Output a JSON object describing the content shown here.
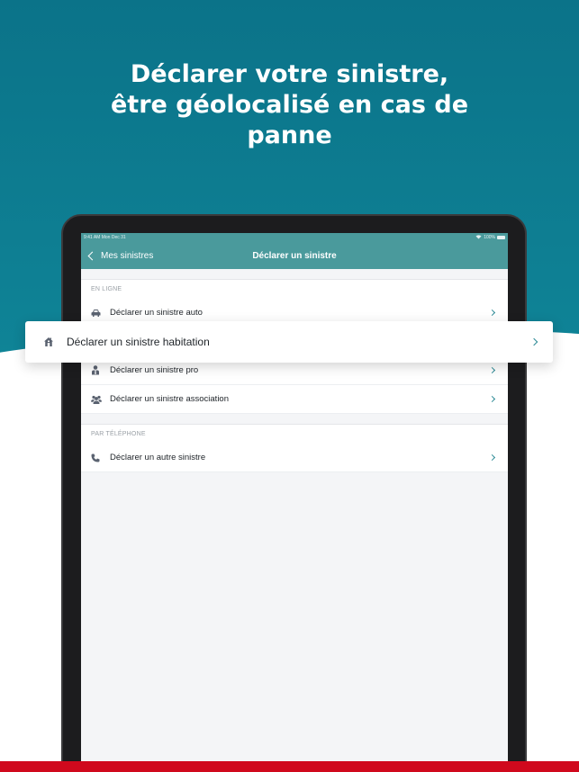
{
  "headline": {
    "line1": "Déclarer votre sinistre,",
    "line2": "être géolocalisé en cas de",
    "line3": "panne"
  },
  "status_bar": {
    "time": "9:41 AM  Mon Dec 31",
    "battery": "100%"
  },
  "nav": {
    "back_label": "Mes sinistres",
    "title": "Déclarer un sinistre"
  },
  "sections": {
    "online": {
      "header": "EN LIGNE",
      "items": [
        {
          "label": "Déclarer un sinistre auto",
          "icon": "car-icon"
        },
        {
          "label": "Déclarer un sinistre habitation",
          "icon": "house-icon"
        },
        {
          "label": "Déclarer un sinistre pro",
          "icon": "professional-icon"
        },
        {
          "label": "Déclarer un sinistre association",
          "icon": "group-icon"
        }
      ]
    },
    "phone": {
      "header": "PAR TÉLÉPHONE",
      "items": [
        {
          "label": "Déclarer un autre sinistre",
          "icon": "phone-icon"
        }
      ]
    }
  },
  "highlight": {
    "label": "Déclarer un sinistre habitation",
    "icon": "house-icon"
  },
  "colors": {
    "teal_background": "#0b7389",
    "nav_bar": "#4a9a9c",
    "chevron": "#2e8b96",
    "bottom_bar": "#d0091d"
  }
}
